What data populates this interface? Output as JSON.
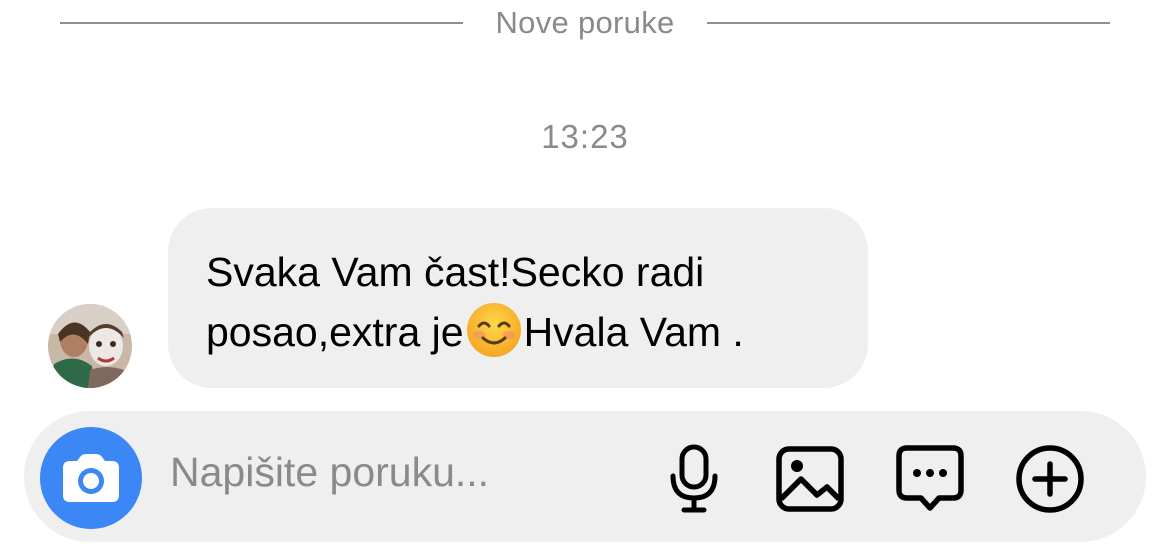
{
  "divider": {
    "label": "Nove poruke"
  },
  "timestamp": "13:23",
  "message": {
    "line1": "Svaka Vam čast!Secko radi",
    "line2_before": "posao,extra je",
    "emoji": "smiling-face-emoji",
    "line2_after": "Hvala Vam ."
  },
  "composer": {
    "placeholder": "Napišite poruku...",
    "icons": [
      "camera-icon",
      "microphone-icon",
      "image-icon",
      "message-dots-icon",
      "plus-circle-icon"
    ],
    "camera_button_color": "#3b87f5"
  },
  "colors": {
    "bubble_bg": "#efefef",
    "muted_text": "#8a8a8a",
    "accent": "#3b87f5"
  }
}
